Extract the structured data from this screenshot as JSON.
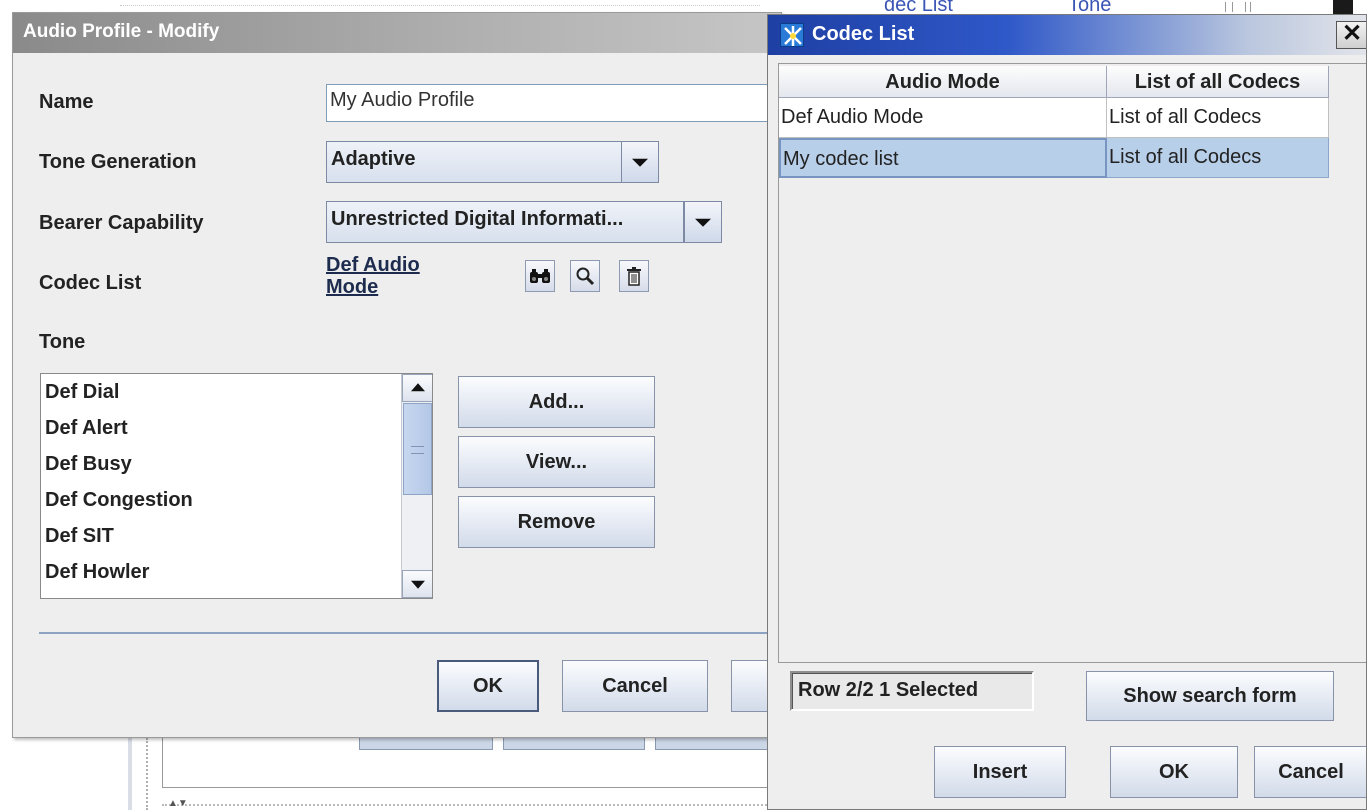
{
  "background": {
    "tabs": [
      "dec List",
      "Tone"
    ]
  },
  "audio_profile": {
    "title": "Audio Profile - Modify",
    "name_label": "Name",
    "name_value": "My Audio Profile",
    "tone_generation_label": "Tone Generation",
    "tone_generation_value": "Adaptive",
    "bearer_capability_label": "Bearer Capability",
    "bearer_capability_value": "Unrestricted Digital Informati...",
    "codec_list_label": "Codec List",
    "codec_list_link_line1": "Def Audio",
    "codec_list_link_line2": "Mode",
    "tone_label": "Tone",
    "tone_items": [
      "Def Dial",
      "Def Alert",
      "Def Busy",
      "Def Congestion",
      "Def SIT",
      "Def Howler"
    ],
    "add_button": "Add...",
    "view_button": "View...",
    "remove_button": "Remove",
    "ok_button": "OK",
    "cancel_button": "Cancel"
  },
  "codec_list": {
    "title": "Codec List",
    "close_symbol": "✕",
    "columns": [
      "Audio Mode",
      "List of all Codecs"
    ],
    "rows": [
      [
        "Def Audio Mode",
        "List of all Codecs"
      ],
      [
        "My codec list",
        "List of all Codecs"
      ]
    ],
    "selected_row": 1,
    "status": "Row 2/2   1 Selected",
    "show_search_form_button": "Show search form",
    "insert_button": "Insert",
    "ok_button": "OK",
    "cancel_button": "Cancel"
  },
  "icons": {
    "find": "binoculars-icon",
    "view": "magnifier-icon",
    "delete": "trash-icon",
    "app": "app-icon"
  }
}
